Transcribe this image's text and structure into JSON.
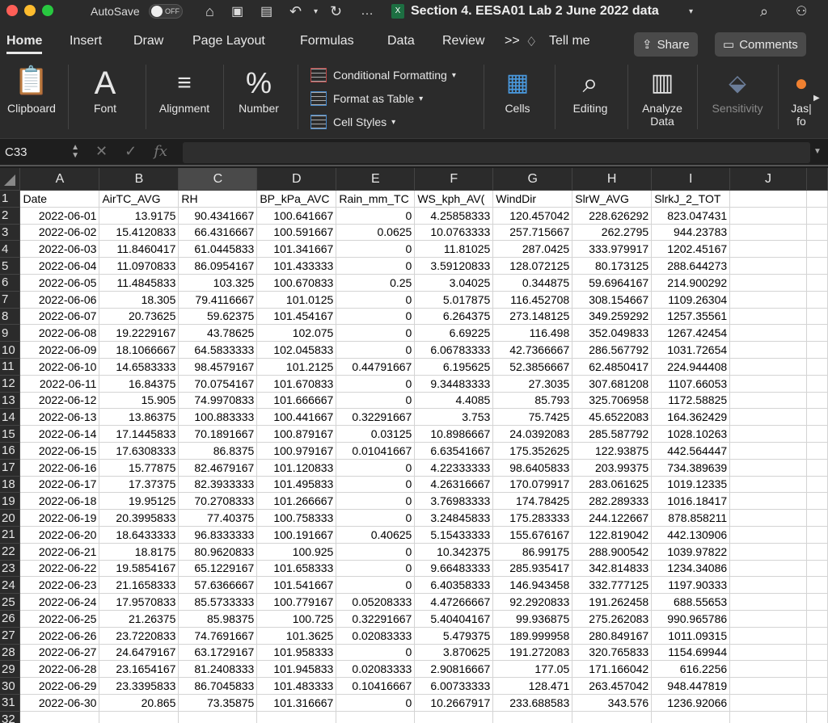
{
  "window": {
    "autosave_label": "AutoSave",
    "autosave_state": "OFF",
    "title": "Section 4. EESA01 Lab 2 June 2022 data"
  },
  "ribbon_tabs": [
    "Home",
    "Insert",
    "Draw",
    "Page Layout",
    "Formulas",
    "Data",
    "Review"
  ],
  "ribbon_more": ">>",
  "tell_me": "Tell me",
  "share_label": "Share",
  "comments_label": "Comments",
  "ribbon_groups": {
    "clipboard": "Clipboard",
    "font": "Font",
    "alignment": "Alignment",
    "number": "Number",
    "conditional_formatting": "Conditional Formatting",
    "format_as_table": "Format as Table",
    "cell_styles": "Cell Styles",
    "cells": "Cells",
    "editing": "Editing",
    "analyze_data_1": "Analyze",
    "analyze_data_2": "Data",
    "sensitivity": "Sensitivity",
    "jasp_1": "Jas|",
    "jasp_2": "fo"
  },
  "formula_bar": {
    "name_box": "C33",
    "fx": "fx",
    "value": ""
  },
  "columns": [
    "A",
    "B",
    "C",
    "D",
    "E",
    "F",
    "G",
    "H",
    "I",
    "J"
  ],
  "selected_column": "C",
  "headers": [
    "Date",
    "AirTC_AVG",
    "RH",
    "BP_kPa_AVG",
    "Rain_mm_TOT",
    "WS_kph_AVG",
    "WindDir",
    "SlrW_AVG",
    "SlrkJ_2_TOT"
  ],
  "header_display": [
    "Date",
    "AirTC_AVG",
    "RH",
    "BP_kPa_AVC",
    "Rain_mm_TC",
    "WS_kph_AV(",
    "WindDir",
    "SlrW_AVG",
    "SlrkJ_2_TOT"
  ],
  "rows": [
    [
      "2022-06-01",
      "13.9175",
      "90.4341667",
      "100.641667",
      "0",
      "4.25858333",
      "120.457042",
      "228.626292",
      "823.047431"
    ],
    [
      "2022-06-02",
      "15.4120833",
      "66.4316667",
      "100.591667",
      "0.0625",
      "10.0763333",
      "257.715667",
      "262.2795",
      "944.23783"
    ],
    [
      "2022-06-03",
      "11.8460417",
      "61.0445833",
      "101.341667",
      "0",
      "11.81025",
      "287.0425",
      "333.979917",
      "1202.45167"
    ],
    [
      "2022-06-04",
      "11.0970833",
      "86.0954167",
      "101.433333",
      "0",
      "3.59120833",
      "128.072125",
      "80.173125",
      "288.644273"
    ],
    [
      "2022-06-05",
      "11.4845833",
      "103.325",
      "100.670833",
      "0.25",
      "3.04025",
      "0.344875",
      "59.6964167",
      "214.900292"
    ],
    [
      "2022-06-06",
      "18.305",
      "79.4116667",
      "101.0125",
      "0",
      "5.017875",
      "116.452708",
      "308.154667",
      "1109.26304"
    ],
    [
      "2022-06-07",
      "20.73625",
      "59.62375",
      "101.454167",
      "0",
      "6.264375",
      "273.148125",
      "349.259292",
      "1257.35561"
    ],
    [
      "2022-06-08",
      "19.2229167",
      "43.78625",
      "102.075",
      "0",
      "6.69225",
      "116.498",
      "352.049833",
      "1267.42454"
    ],
    [
      "2022-06-09",
      "18.1066667",
      "64.5833333",
      "102.045833",
      "0",
      "6.06783333",
      "42.7366667",
      "286.567792",
      "1031.72654"
    ],
    [
      "2022-06-10",
      "14.6583333",
      "98.4579167",
      "101.2125",
      "0.44791667",
      "6.195625",
      "52.3856667",
      "62.4850417",
      "224.944408"
    ],
    [
      "2022-06-11",
      "16.84375",
      "70.0754167",
      "101.670833",
      "0",
      "9.34483333",
      "27.3035",
      "307.681208",
      "1107.66053"
    ],
    [
      "2022-06-12",
      "15.905",
      "74.9970833",
      "101.666667",
      "0",
      "4.4085",
      "85.793",
      "325.706958",
      "1172.58825"
    ],
    [
      "2022-06-13",
      "13.86375",
      "100.883333",
      "100.441667",
      "0.32291667",
      "3.753",
      "75.7425",
      "45.6522083",
      "164.362429"
    ],
    [
      "2022-06-14",
      "17.1445833",
      "70.1891667",
      "100.879167",
      "0.03125",
      "10.8986667",
      "24.0392083",
      "285.587792",
      "1028.10263"
    ],
    [
      "2022-06-15",
      "17.6308333",
      "86.8375",
      "100.979167",
      "0.01041667",
      "6.63541667",
      "175.352625",
      "122.93875",
      "442.564447"
    ],
    [
      "2022-06-16",
      "15.77875",
      "82.4679167",
      "101.120833",
      "0",
      "4.22333333",
      "98.6405833",
      "203.99375",
      "734.389639"
    ],
    [
      "2022-06-17",
      "17.37375",
      "82.3933333",
      "101.495833",
      "0",
      "4.26316667",
      "170.079917",
      "283.061625",
      "1019.12335"
    ],
    [
      "2022-06-18",
      "19.95125",
      "70.2708333",
      "101.266667",
      "0",
      "3.76983333",
      "174.78425",
      "282.289333",
      "1016.18417"
    ],
    [
      "2022-06-19",
      "20.3995833",
      "77.40375",
      "100.758333",
      "0",
      "3.24845833",
      "175.283333",
      "244.122667",
      "878.858211"
    ],
    [
      "2022-06-20",
      "18.6433333",
      "96.8333333",
      "100.191667",
      "0.40625",
      "5.15433333",
      "155.676167",
      "122.819042",
      "442.130906"
    ],
    [
      "2022-06-21",
      "18.8175",
      "80.9620833",
      "100.925",
      "0",
      "10.342375",
      "86.99175",
      "288.900542",
      "1039.97822"
    ],
    [
      "2022-06-22",
      "19.5854167",
      "65.1229167",
      "101.658333",
      "0",
      "9.66483333",
      "285.935417",
      "342.814833",
      "1234.34086"
    ],
    [
      "2022-06-23",
      "21.1658333",
      "57.6366667",
      "101.541667",
      "0",
      "6.40358333",
      "146.943458",
      "332.777125",
      "1197.90333"
    ],
    [
      "2022-06-24",
      "17.9570833",
      "85.5733333",
      "100.779167",
      "0.05208333",
      "4.47266667",
      "92.2920833",
      "191.262458",
      "688.55653"
    ],
    [
      "2022-06-25",
      "21.26375",
      "85.98375",
      "100.725",
      "0.32291667",
      "5.40404167",
      "99.936875",
      "275.262083",
      "990.965786"
    ],
    [
      "2022-06-26",
      "23.7220833",
      "74.7691667",
      "101.3625",
      "0.02083333",
      "5.479375",
      "189.999958",
      "280.849167",
      "1011.09315"
    ],
    [
      "2022-06-27",
      "24.6479167",
      "63.1729167",
      "101.958333",
      "0",
      "3.870625",
      "191.272083",
      "320.765833",
      "1154.69944"
    ],
    [
      "2022-06-28",
      "23.1654167",
      "81.2408333",
      "101.945833",
      "0.02083333",
      "2.90816667",
      "177.05",
      "171.166042",
      "616.2256"
    ],
    [
      "2022-06-29",
      "23.3395833",
      "86.7045833",
      "101.483333",
      "0.10416667",
      "6.00733333",
      "128.471",
      "263.457042",
      "948.447819"
    ],
    [
      "2022-06-30",
      "20.865",
      "73.35875",
      "101.316667",
      "0",
      "10.2667917",
      "233.688583",
      "343.576",
      "1236.92066"
    ]
  ],
  "colors": {
    "chrome": "#2b2b2b",
    "close": "#ff5f57",
    "minimize": "#febc2e",
    "zoom": "#28c840",
    "excel": "#1d6f42"
  }
}
